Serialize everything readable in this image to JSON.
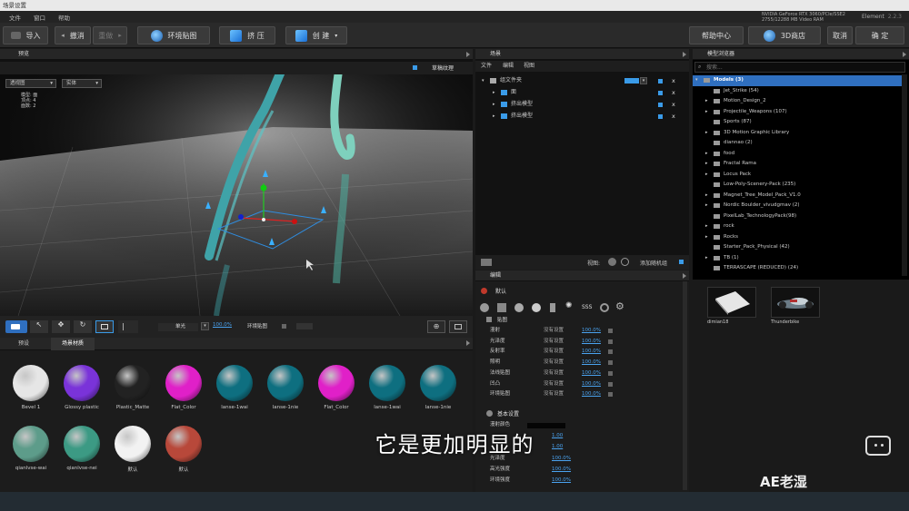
{
  "title_bar": {
    "text": "场景设置"
  },
  "menu": {
    "items": [
      "文件",
      "窗口",
      "帮助"
    ]
  },
  "gpu": {
    "line1": "NVIDIA GeForce RTX 3060/PCIe/SSE2",
    "line2": "2755/12288 MB Video RAM"
  },
  "app_label": "Element",
  "app_version": "2.2.3",
  "toolbar": {
    "import": "导入",
    "undo": "撤消",
    "redo": "重做",
    "env_map": "环境贴图",
    "extrude": "挤 压",
    "create": "创 建",
    "help": "帮助中心",
    "store": "3D商店",
    "cancel": "取消",
    "ok": "确 定"
  },
  "viewport": {
    "header": "预览",
    "draft_texture": "草稿纹理",
    "view_dropdown": "透视图",
    "render_dropdown": "实体",
    "stats": {
      "models_label": "模型:",
      "models_value": "面",
      "vertices_label": "顶点:",
      "vertices_value": "4",
      "faces_label": "面数:",
      "faces_value": "2"
    },
    "bottom": {
      "mode": "单光",
      "zoom": "100.0%",
      "env": "环境贴图"
    }
  },
  "materials": {
    "tabs": [
      "预设",
      "场景材质"
    ],
    "items": [
      {
        "label": "Bevel 1",
        "color": "#e6e6e6"
      },
      {
        "label": "Glossy plastic",
        "color": "#7a33d9"
      },
      {
        "label": "Plastic_Matte",
        "color": "#222222"
      },
      {
        "label": "Flat_Color",
        "color": "#e020c8"
      },
      {
        "label": "lanse-1wai",
        "color": "#0e6f80"
      },
      {
        "label": "lanse-1nie",
        "color": "#0e6f80"
      },
      {
        "label": "Flat_Color",
        "color": "#e020c8"
      },
      {
        "label": "lanse-1wai",
        "color": "#0e6f80"
      },
      {
        "label": "lanse-1nie",
        "color": "#0e6f80"
      },
      {
        "label": "qianlvse-wai",
        "color": "#5d9c8a"
      },
      {
        "label": "qianlvse-nei",
        "color": "#3c9a84"
      },
      {
        "label": "默认",
        "color": "#f2f2f2"
      },
      {
        "label": "默认",
        "color": "#b8483a"
      }
    ]
  },
  "scene": {
    "header": "场景",
    "menu": [
      "文件",
      "编辑",
      "视图"
    ],
    "items": [
      {
        "label": "组文件夹",
        "level": 0
      },
      {
        "label": "面",
        "level": 1
      },
      {
        "label": "挤出模型",
        "level": 1
      },
      {
        "label": "挤出模型",
        "level": 1
      }
    ],
    "view_label": "视图:",
    "add_label": "添加随机组"
  },
  "edit": {
    "header": "编辑",
    "material_name": "默认",
    "section_map": "贴图",
    "rows": [
      {
        "label": "漫射",
        "value": "没有设置",
        "pct": "100.0%"
      },
      {
        "label": "光泽度",
        "value": "没有设置",
        "pct": "100.0%"
      },
      {
        "label": "反射率",
        "value": "没有设置",
        "pct": "100.0%"
      },
      {
        "label": "照明",
        "value": "没有设置",
        "pct": "100.0%"
      },
      {
        "label": "法线贴图",
        "value": "没有设置",
        "pct": "100.0%"
      },
      {
        "label": "凹凸",
        "value": "没有设置",
        "pct": "100.0%"
      },
      {
        "label": "环境贴图",
        "value": "没有设置",
        "pct": "100.0%"
      }
    ],
    "section_basic": "基本设置",
    "basic": [
      {
        "label": "漫射颜色",
        "value": ""
      },
      {
        "label": "",
        "value": "1.00"
      },
      {
        "label": "",
        "value": "1.00"
      },
      {
        "label": "光泽度",
        "value": "100.0%"
      },
      {
        "label": "高光强度",
        "value": "100.0%"
      },
      {
        "label": "环境强度",
        "value": "100.0%"
      }
    ]
  },
  "models": {
    "header": "模型浏览器",
    "search_placeholder": "搜索...",
    "items": [
      {
        "label": "Models (3)",
        "level": 0
      },
      {
        "label": "Jet_Strike (54)",
        "level": 1
      },
      {
        "label": "Motion_Design_2",
        "level": 1
      },
      {
        "label": "Projectile_Weapons (107)",
        "level": 1
      },
      {
        "label": "Sports (87)",
        "level": 1
      },
      {
        "label": "3D Motion Graphic Library",
        "level": 1
      },
      {
        "label": "diannao (2)",
        "level": 1
      },
      {
        "label": "food",
        "level": 1
      },
      {
        "label": "Fractal Rama",
        "level": 1
      },
      {
        "label": "Locus Pack",
        "level": 1
      },
      {
        "label": "Low-Poly-Scenery-Pack (235)",
        "level": 1
      },
      {
        "label": "Magnet_Tree_Model_Pack_V1.0",
        "level": 1
      },
      {
        "label": "Nordic Boulder_vivudgmav (2)",
        "level": 1
      },
      {
        "label": "PixelLab_TechnologyPack(98)",
        "level": 1
      },
      {
        "label": "rock",
        "level": 1
      },
      {
        "label": "Rocks",
        "level": 1
      },
      {
        "label": "Starter_Pack_Physical (42)",
        "level": 1
      },
      {
        "label": "TB (1)",
        "level": 1
      },
      {
        "label": "TERRASCAPE (REDUCED) (24)",
        "level": 1
      }
    ],
    "thumbs": [
      {
        "label": "dimian18"
      },
      {
        "label": "Thunderbike"
      }
    ]
  },
  "subtitle": "它是更加明显的",
  "watermark": "AE老湿"
}
